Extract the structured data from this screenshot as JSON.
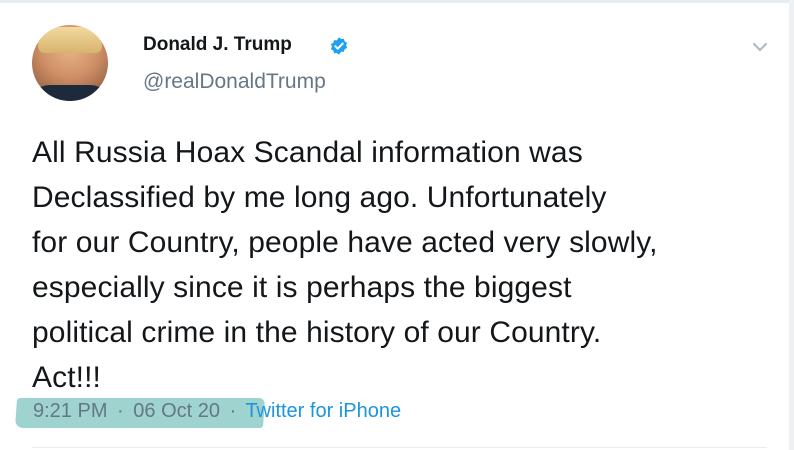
{
  "tweet": {
    "author": {
      "name": "Donald J. Trump",
      "handle": "@realDonaldTrump",
      "verified": true
    },
    "text": "All Russia Hoax Scandal information was\nDeclassified by me long ago. Unfortunately\nfor our Country, people have acted very slowly,\nespecially since it is perhaps the biggest\npolitical crime in the history of our Country.\nAct!!!",
    "time": "9:21 PM",
    "separator": "·",
    "date": "06 Oct 20",
    "source": "Twitter for iPhone"
  },
  "icons": {
    "verified": "verified-badge-icon",
    "menu": "chevron-down-icon"
  },
  "colors": {
    "verified_blue": "#1da1f2",
    "link_blue": "#1b95e0",
    "secondary_text": "#657786",
    "highlight": "#8ecbc8"
  }
}
